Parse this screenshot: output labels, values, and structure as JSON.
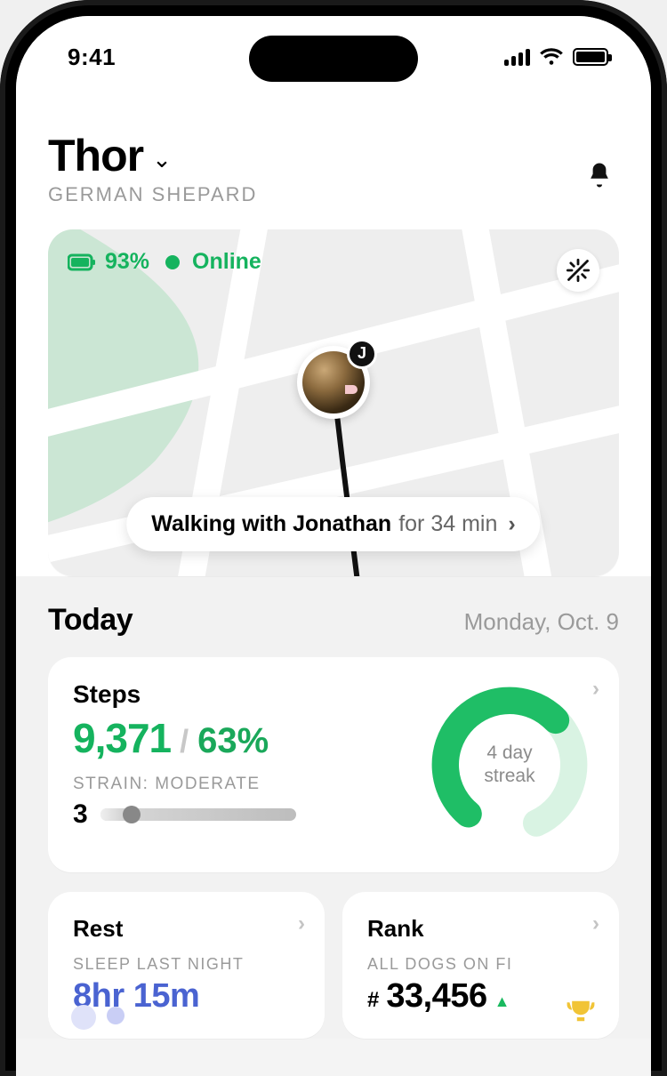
{
  "status": {
    "time": "9:41"
  },
  "pet": {
    "name": "Thor",
    "breed": "GERMAN SHEPARD",
    "owner_initial": "J"
  },
  "device": {
    "battery_pct": "93%",
    "status_label": "Online"
  },
  "activity_pill": {
    "main": "Walking with Jonathan",
    "sub": "for 34 min"
  },
  "today": {
    "title": "Today",
    "date": "Monday, Oct. 9"
  },
  "steps": {
    "title": "Steps",
    "count": "9,371",
    "pct": "63%",
    "strain_label": "STRAIN: MODERATE",
    "strain_value": "3",
    "streak_line1": "4 day",
    "streak_line2": "streak",
    "ring_progress": 0.63
  },
  "rest": {
    "title": "Rest",
    "sub": "SLEEP LAST NIGHT",
    "value": "8hr 15m"
  },
  "rank": {
    "title": "Rank",
    "sub": "ALL DOGS ON FI",
    "hash": "#",
    "value": "33,456",
    "trend": "up"
  }
}
